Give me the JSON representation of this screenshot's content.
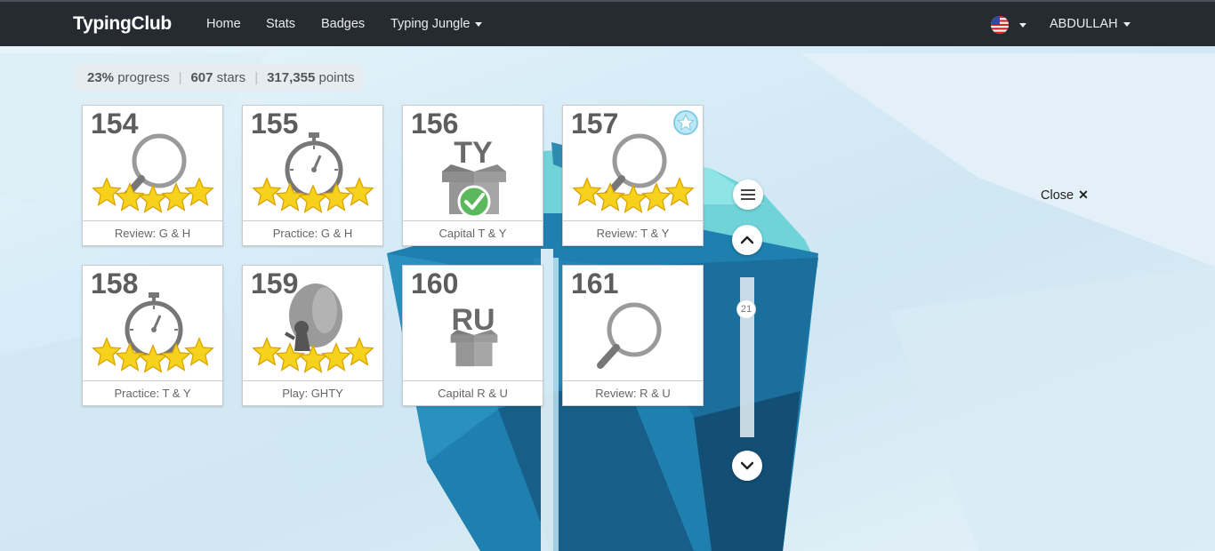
{
  "navbar": {
    "brand": "TypingClub",
    "links": [
      {
        "label": "Home"
      },
      {
        "label": "Stats"
      },
      {
        "label": "Badges"
      },
      {
        "label": "Typing Jungle"
      }
    ],
    "user": "ABDULLAH"
  },
  "progress": {
    "percent": "23%",
    "percent_label": "progress",
    "stars": "607",
    "stars_label": "stars",
    "points": "317,355",
    "points_label": "points"
  },
  "lessons": [
    {
      "number": "154",
      "label": "Review: G & H",
      "icon": "magnifier-icon",
      "stars": 5
    },
    {
      "number": "155",
      "label": "Practice: G & H",
      "icon": "stopwatch-icon",
      "stars": 5
    },
    {
      "number": "156",
      "label": "Capital T & Y",
      "icon": "box-icon",
      "box_letters": "TY",
      "completed": true
    },
    {
      "number": "157",
      "label": "Review: T & Y",
      "icon": "magnifier-icon",
      "stars": 5,
      "badge": "ribbon-star-icon"
    },
    {
      "number": "158",
      "label": "Practice: T & Y",
      "icon": "stopwatch-icon",
      "stars": 5
    },
    {
      "number": "159",
      "label": "Play: GHTY",
      "icon": "balloon-game-icon",
      "stars": 5
    },
    {
      "number": "160",
      "label": "Capital R & U",
      "icon": "box-icon",
      "box_letters": "RU"
    },
    {
      "number": "161",
      "label": "Review: R & U",
      "icon": "magnifier-icon"
    }
  ],
  "controls": {
    "scroll_position": "21",
    "close_label": "Close",
    "close_symbol": "✕"
  },
  "colors": {
    "navbar_bg": "#262b31",
    "star_yellow": "#f7d21c",
    "check_green": "#5cb85c",
    "icon_gray": "#8e8e8e"
  }
}
